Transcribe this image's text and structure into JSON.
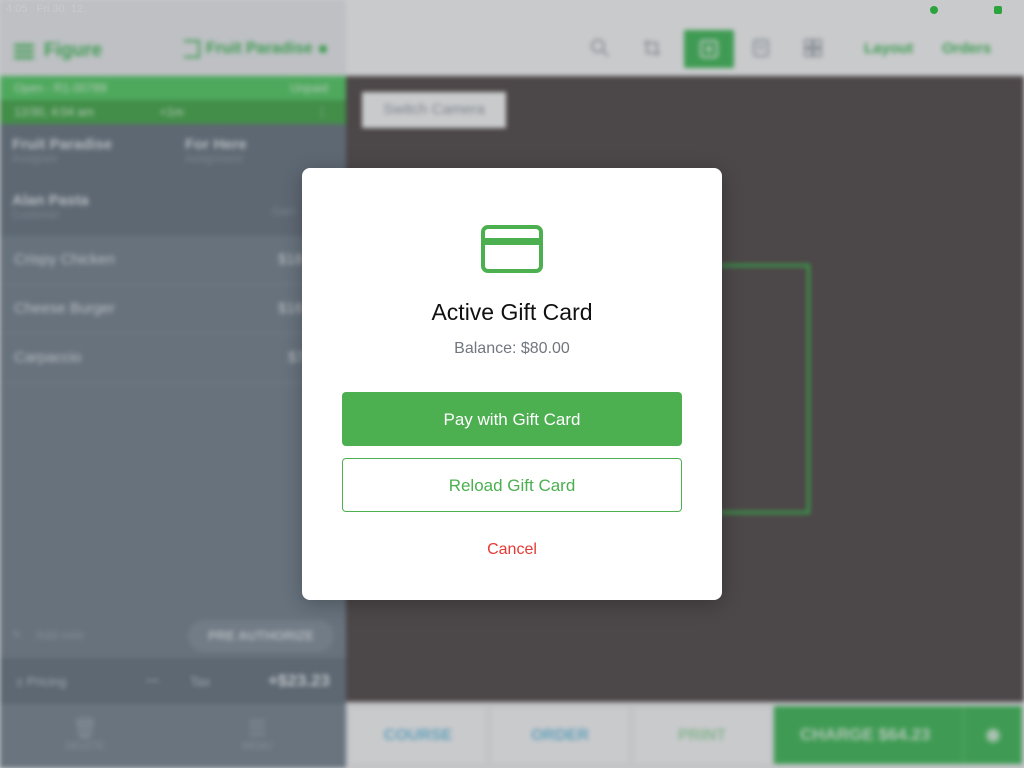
{
  "status_bar": {
    "time": "4:05",
    "date": "Fri 30. 12."
  },
  "app": {
    "name": "Figure",
    "venue": "Fruit Paradise"
  },
  "order": {
    "status": "Open - R1-00789",
    "payment_status": "Unpaid",
    "datetime": "12/30, 4:04 am",
    "elapsed": "<1m",
    "assignee": {
      "value": "Fruit Paradise",
      "label": "Assignee"
    },
    "assignment": {
      "value": "For Here",
      "label": "Assignment"
    },
    "customer": {
      "value": "Alan Pasta",
      "label": "Customer",
      "extra": "Gam"
    },
    "items": [
      {
        "name": "Crispy Chicken",
        "price": "$18"
      },
      {
        "name": "Cheese Burger",
        "price": "$16"
      },
      {
        "name": "Carpaccio",
        "price": "$7"
      }
    ],
    "add_note": "Add note",
    "pre_authorize": "PRE AUTHORIZE",
    "pricing_label": "Pricing",
    "pricing_value": "—",
    "tax_label": "Tax",
    "tax_value": "+$23.23"
  },
  "left_nav": {
    "delete": "DELETE",
    "menu": "MENU"
  },
  "toolbar": {
    "layout": "Layout",
    "orders": "Orders"
  },
  "camera": {
    "switch_label": "Switch Camera"
  },
  "actions": {
    "course": "COURSE",
    "order": "ORDER",
    "print": "PRINT",
    "charge": "CHARGE $64.23"
  },
  "modal": {
    "title": "Active Gift Card",
    "balance": "Balance: $80.00",
    "pay_label": "Pay with Gift Card",
    "reload_label": "Reload Gift Card",
    "cancel_label": "Cancel"
  },
  "colors": {
    "accent": "#4caf50",
    "danger": "#e53935",
    "brand": "#47c15e"
  }
}
